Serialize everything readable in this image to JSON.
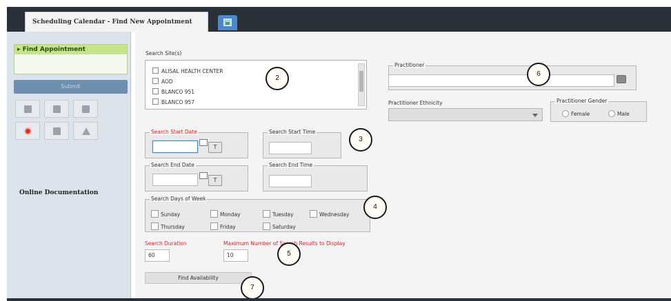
{
  "tabs": {
    "active_label": "Scheduling Calendar - Find New Appointment",
    "icon_tab": "image-icon"
  },
  "sidebar": {
    "find_appointment_label": "Find Appointment",
    "submit_label": "Submit",
    "online_documentation": "Online Documentation",
    "icons": [
      "print-icon",
      "printer-icon",
      "document-icon",
      "cancel-icon",
      "people-icon",
      "star-icon"
    ]
  },
  "search_sites": {
    "label": "Search Site(s)",
    "items": [
      "ALISAL HEALTH CENTER",
      "AOD",
      "BLANCO 951",
      "BLANCO 957"
    ]
  },
  "start_date": {
    "label": "Search Start Date",
    "value": "",
    "today_button": "T"
  },
  "start_time": {
    "label": "Search Start Time",
    "value": ""
  },
  "end_date": {
    "label": "Search End Date",
    "value": "",
    "today_button": "T"
  },
  "end_time": {
    "label": "Search End Time",
    "value": ""
  },
  "days_of_week": {
    "label": "Search Days of Week",
    "days": [
      "Sunday",
      "Monday",
      "Tuesday",
      "Wednesday",
      "Thursday",
      "Friday",
      "Saturday"
    ]
  },
  "duration": {
    "label": "Search Duration",
    "value": "60"
  },
  "max_results": {
    "label": "Maximum Number of Search Results to Display",
    "value": "10"
  },
  "find_button": "Find Availability",
  "practitioner": {
    "label": "Practitioner",
    "value": ""
  },
  "ethnicity": {
    "label": "Practitioner Ethnicity",
    "value": ""
  },
  "gender": {
    "label": "Practitioner Gender",
    "options": [
      "Female",
      "Male"
    ]
  },
  "callouts": [
    "2",
    "3",
    "4",
    "5",
    "6",
    "7"
  ]
}
